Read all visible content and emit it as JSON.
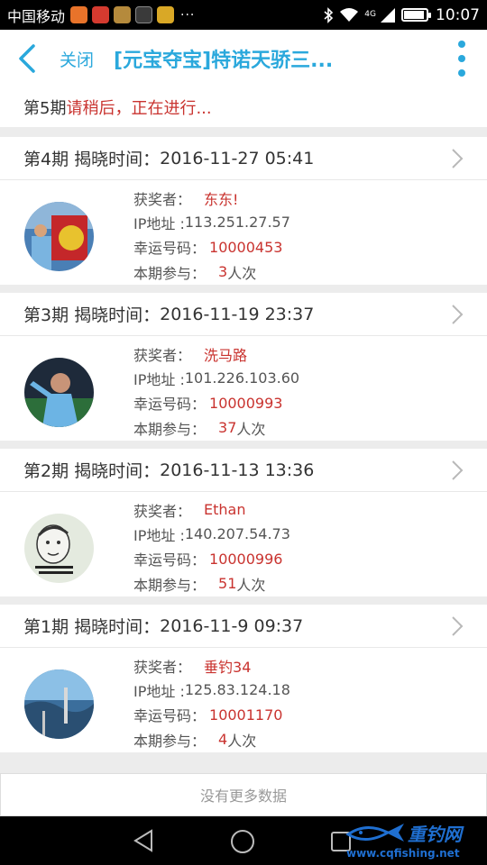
{
  "status_bar": {
    "carrier": "中国移动",
    "more": "···",
    "network": "4G",
    "time": "10:07",
    "battery_level": 0.9
  },
  "header": {
    "close_label": "关闭",
    "title": "[元宝夺宝]特诺天骄三..."
  },
  "current": {
    "period": "第5期",
    "status": "请稍后，正在进行..."
  },
  "labels": {
    "reveal_time": "揭晓时间：",
    "winner": "获奖者：",
    "ip": "IP地址 : ",
    "lucky_number": "幸运号码：",
    "participation": "本期参与："
  },
  "periods": [
    {
      "period": "第4期",
      "time": "2016-11-27 05:41",
      "winner": "东东!",
      "ip": "113.251.27.57",
      "lucky_number": "10000453",
      "count": "3",
      "unit": "人次"
    },
    {
      "period": "第3期",
      "time": "2016-11-19 23:37",
      "winner": "洗马路",
      "ip": "101.226.103.60",
      "lucky_number": "10000993",
      "count": "37",
      "unit": "人次"
    },
    {
      "period": "第2期",
      "time": "2016-11-13 13:36",
      "winner": "Ethan",
      "ip": "140.207.54.73",
      "lucky_number": "10000996",
      "count": "51",
      "unit": "人次"
    },
    {
      "period": "第1期",
      "time": "2016-11-9 09:37",
      "winner": "垂钓34",
      "ip": "125.83.124.18",
      "lucky_number": "10001170",
      "count": "4",
      "unit": "人次"
    }
  ],
  "footer": {
    "no_more": "没有更多数据"
  },
  "watermark": {
    "name": "重钓网",
    "url": "www.cqfishing.net"
  },
  "colors": {
    "accent": "#2aa8dc",
    "highlight": "#c9332f"
  }
}
